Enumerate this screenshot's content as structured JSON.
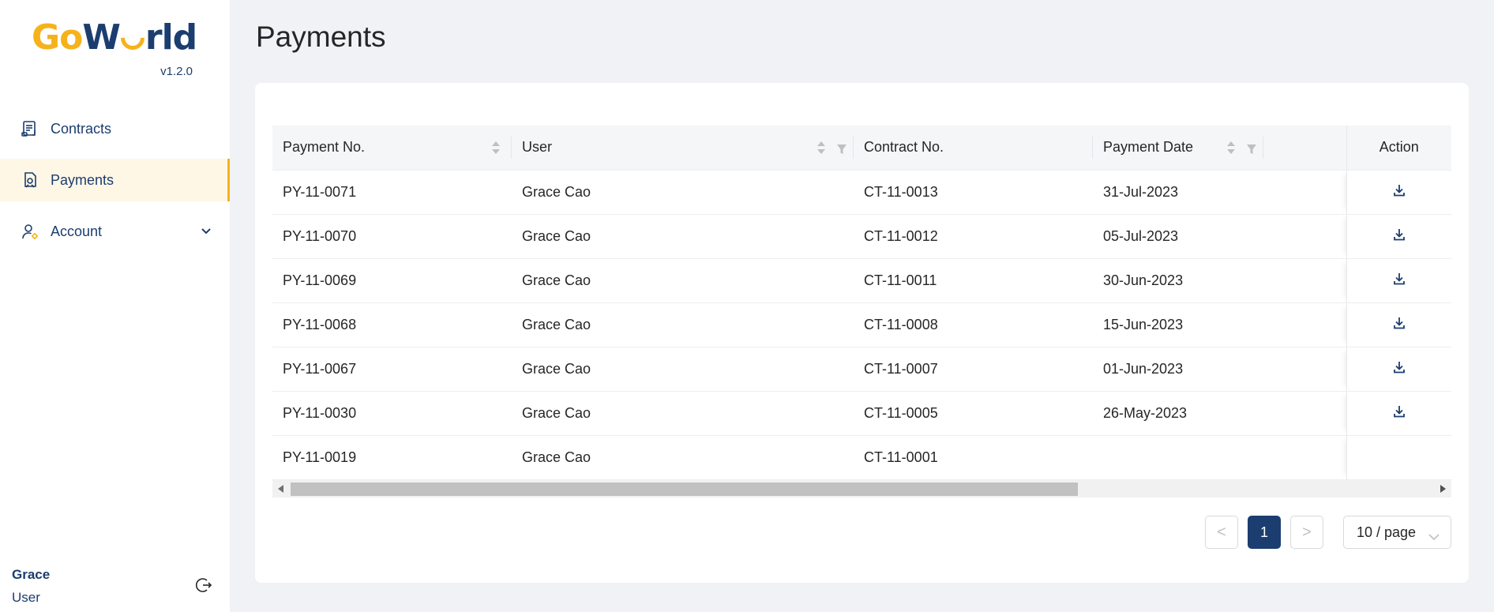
{
  "app": {
    "logo_text": "GoWorld",
    "version": "v1.2.0"
  },
  "sidebar": {
    "items": [
      {
        "label": "Contracts",
        "icon": "contract-icon",
        "active": false
      },
      {
        "label": "Payments",
        "icon": "payment-icon",
        "active": true
      },
      {
        "label": "Account",
        "icon": "account-settings-icon",
        "active": false,
        "expandable": true
      }
    ],
    "user": {
      "name": "Grace",
      "role": "User"
    }
  },
  "page": {
    "title": "Payments"
  },
  "table": {
    "columns": [
      "Payment No.",
      "User",
      "Contract No.",
      "Payment Date",
      "",
      "Action"
    ],
    "rows": [
      {
        "payment_no": "PY-11-0071",
        "user": "Grace Cao",
        "contract_no": "CT-11-0013",
        "payment_date": "31-Jul-2023",
        "download": true
      },
      {
        "payment_no": "PY-11-0070",
        "user": "Grace Cao",
        "contract_no": "CT-11-0012",
        "payment_date": "05-Jul-2023",
        "download": true
      },
      {
        "payment_no": "PY-11-0069",
        "user": "Grace Cao",
        "contract_no": "CT-11-0011",
        "payment_date": "30-Jun-2023",
        "download": true
      },
      {
        "payment_no": "PY-11-0068",
        "user": "Grace Cao",
        "contract_no": "CT-11-0008",
        "payment_date": "15-Jun-2023",
        "download": true
      },
      {
        "payment_no": "PY-11-0067",
        "user": "Grace Cao",
        "contract_no": "CT-11-0007",
        "payment_date": "01-Jun-2023",
        "download": true
      },
      {
        "payment_no": "PY-11-0030",
        "user": "Grace Cao",
        "contract_no": "CT-11-0005",
        "payment_date": "26-May-2023",
        "download": true
      },
      {
        "payment_no": "PY-11-0019",
        "user": "Grace Cao",
        "contract_no": "CT-11-0001",
        "payment_date": "",
        "download": false
      }
    ]
  },
  "pagination": {
    "prev": "<",
    "current": "1",
    "next": ">",
    "page_size": "10 / page"
  },
  "colors": {
    "brand_navy": "#1c3d6f",
    "brand_yellow": "#f5b21b",
    "active_bg": "#fff7e6"
  }
}
